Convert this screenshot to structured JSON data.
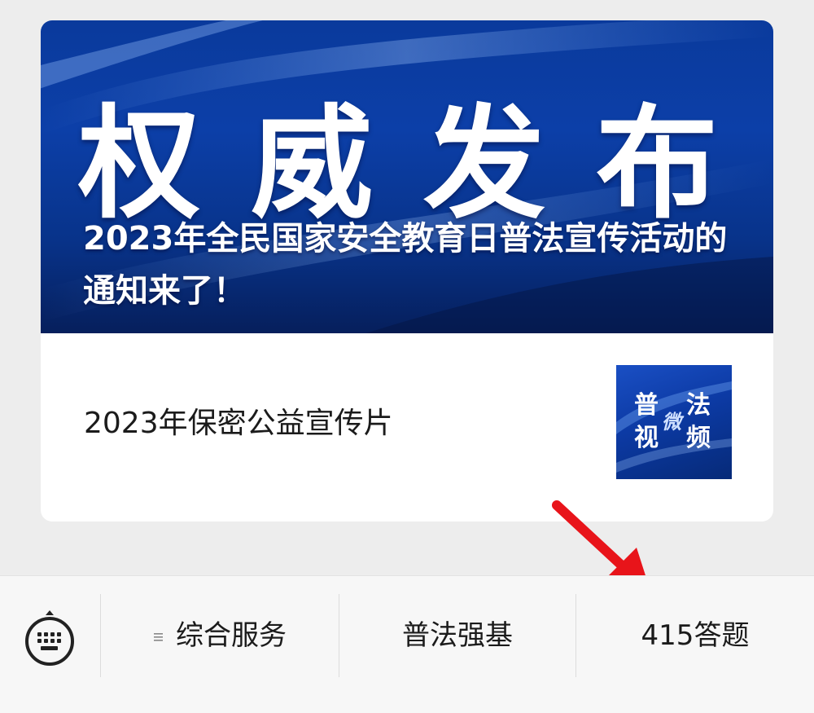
{
  "banner": {
    "title": "权威发布",
    "subtitle": "2023年全民国家安全教育日普法宣传活动的通知来了！"
  },
  "article": {
    "title": "2023年保密公益宣传片",
    "thumbnail": {
      "char1": "普",
      "char2": "法",
      "char3": "微",
      "char4": "视",
      "char5": "频"
    }
  },
  "annotation": {
    "arrow_color": "#e8141a"
  },
  "menu": {
    "keyboard_icon": "keyboard-icon",
    "items": [
      {
        "label": "综合服务",
        "icon": "menu-lines-icon"
      },
      {
        "label": "普法强基"
      },
      {
        "label": "415答题"
      }
    ]
  }
}
